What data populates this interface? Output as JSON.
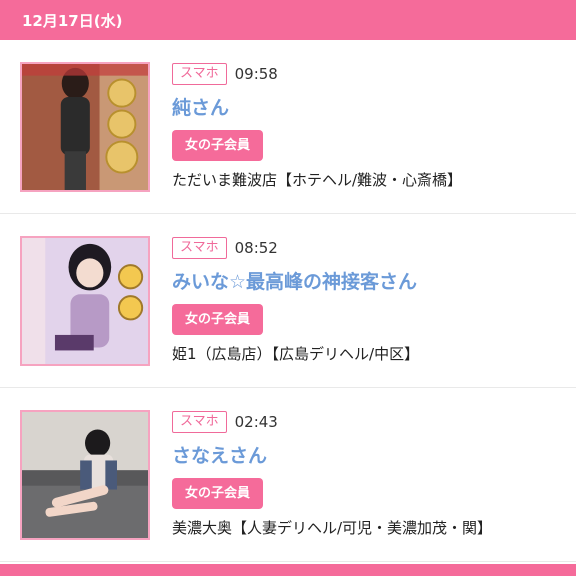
{
  "header": {
    "date": "12月17日(水)"
  },
  "colors": {
    "accent": "#f56b9a",
    "name": "#6b9ad8",
    "badge_border": "#f06a9a"
  },
  "entries": [
    {
      "device": "スマホ",
      "time": "09:58",
      "name": "純さん",
      "member_label": "女の子会員",
      "shop": "ただいま難波店【ホテヘル/難波・心斎橋】",
      "thumb_icon": "girl-photo-icon"
    },
    {
      "device": "スマホ",
      "time": "08:52",
      "name": "みいな☆最高峰の神接客さん",
      "member_label": "女の子会員",
      "shop": "姫1（広島店）【広島デリヘル/中区】",
      "thumb_icon": "girl-photo-icon"
    },
    {
      "device": "スマホ",
      "time": "02:43",
      "name": "さなえさん",
      "member_label": "女の子会員",
      "shop": "美濃大奥【人妻デリヘル/可児・美濃加茂・関】",
      "thumb_icon": "girl-photo-icon"
    }
  ]
}
